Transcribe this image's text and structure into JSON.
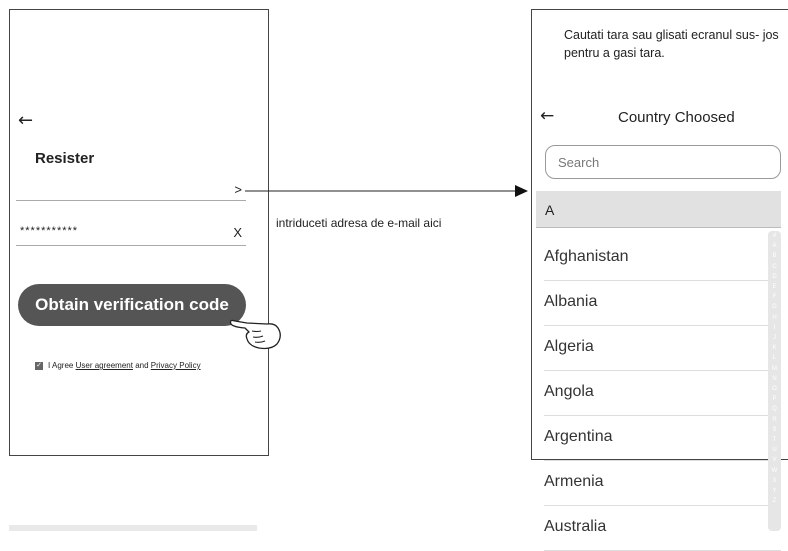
{
  "left_screen": {
    "back_icon": "back-arrow",
    "title": "Resister",
    "email_chevron": ">",
    "password_value": "***********",
    "clear_label": "X",
    "obtain_button": "Obtain verification code",
    "agree_prefix": "I Agree",
    "agree_link1": "User agreement",
    "agree_middle": "and",
    "agree_link2": "Privacy Policy"
  },
  "annotation": "intriduceti adresa de e-mail aici",
  "right_screen": {
    "hint": "Cautati tara sau glisati ecranul sus- jos pentru a gasi tara.",
    "back_icon": "back-arrow",
    "title": "Country Choosed",
    "search_placeholder": "Search",
    "section_letter": "A",
    "countries": [
      "Afghanistan",
      "Albania",
      "Algeria",
      "Angola",
      "Argentina",
      "Armenia",
      "Australia"
    ],
    "index_letters": [
      "#",
      "A",
      "B",
      "C",
      "D",
      "E",
      "F",
      "G",
      "H",
      "I",
      "J",
      "K",
      "L",
      "M",
      "N",
      "O",
      "P",
      "Q",
      "R",
      "S",
      "T",
      "U",
      "V",
      "W",
      "X",
      "Y",
      "Z"
    ]
  },
  "colors": {
    "button_bg": "#555555",
    "header_bg": "#e1e1e1",
    "index_bg": "#e6e6e6"
  }
}
